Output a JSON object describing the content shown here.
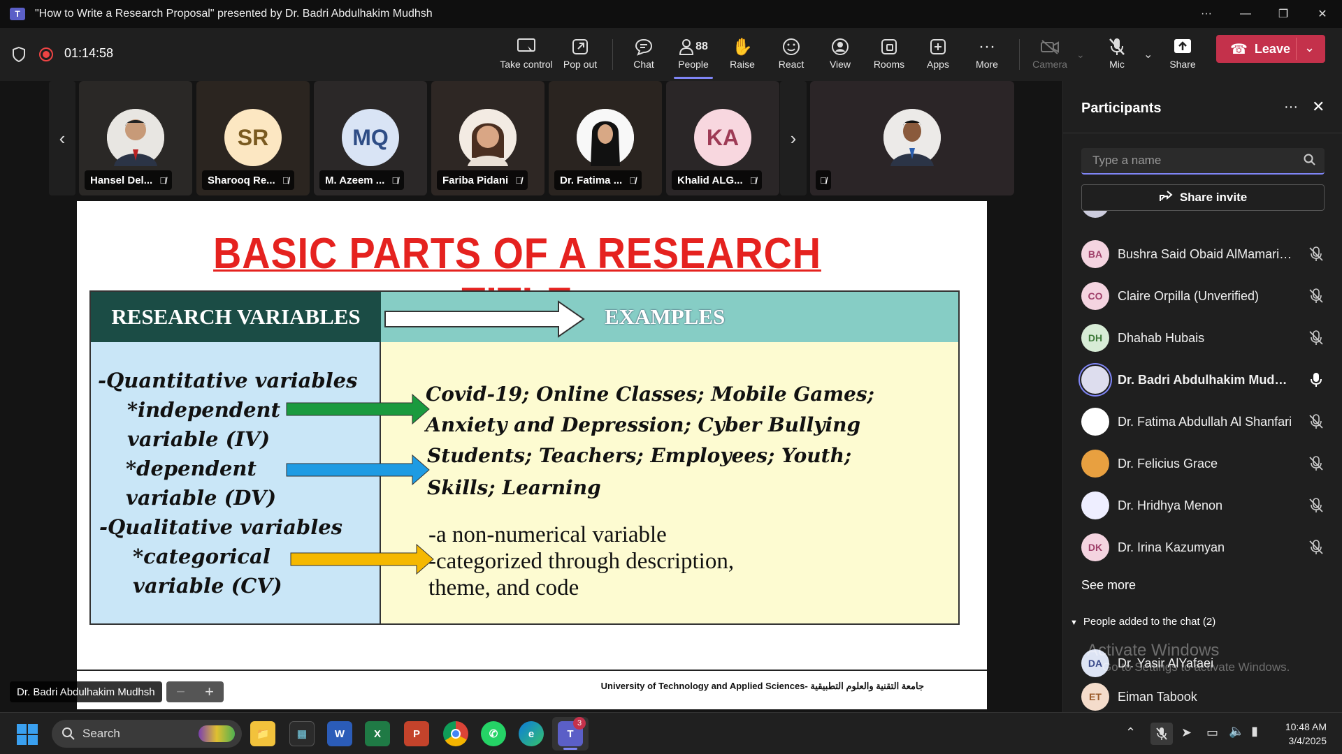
{
  "window": {
    "title": "\"How to Write a Research Proposal\" presented by Dr. Badri Abdulhakim Mudhsh",
    "icon": "teams-icon"
  },
  "toolbar": {
    "timer": "01:14:58",
    "take_control": "Take control",
    "pop_out": "Pop out",
    "chat": "Chat",
    "people": "People",
    "people_count": "88",
    "raise": "Raise",
    "react": "React",
    "view": "View",
    "rooms": "Rooms",
    "apps": "Apps",
    "more": "More",
    "camera": "Camera",
    "mic": "Mic",
    "share": "Share",
    "leave": "Leave"
  },
  "tiles": [
    {
      "name": "Hansel Del...",
      "initials": "",
      "type": "photo"
    },
    {
      "name": "Sharooq Re...",
      "initials": "SR",
      "type": "initials"
    },
    {
      "name": "M. Azeem ...",
      "initials": "MQ",
      "type": "initials"
    },
    {
      "name": "Fariba Pidani",
      "initials": "",
      "type": "photo"
    },
    {
      "name": "Dr. Fatima ...",
      "initials": "",
      "type": "photo"
    },
    {
      "name": "Khalid ALG...",
      "initials": "KA",
      "type": "initials"
    },
    {
      "name": "",
      "initials": "",
      "type": "photo"
    }
  ],
  "slide": {
    "title": "BASIC PARTS OF A RESEARCH TITLE",
    "header_left": "RESEARCH VARIABLES",
    "header_right": "EXAMPLES",
    "left": {
      "quant": "-Quantitative variables",
      "iv1": "*independent",
      "iv2": "variable (IV)",
      "dv1": "*dependent",
      "dv2": "variable (DV)",
      "qual": "-Qualitative variables",
      "cv1": "*categorical",
      "cv2": "variable (CV)"
    },
    "right": {
      "iv_line1": "Covid-19; Online Classes; Mobile Games;",
      "iv_line2": "Anxiety and Depression;  Cyber Bullying",
      "dv_line1": "Students; Teachers; Employees;  Youth;",
      "dv_line2": "Skills; Learning",
      "cv_line1": "-a non-numerical variable",
      "cv_line2": "-categorized through description,",
      "cv_line3": "theme, and code"
    },
    "footer": "University of Technology and Applied Sciences- جامعة التقنية والعلوم التطبيقية",
    "colors": {
      "title": "#e5221f",
      "arrow_iv": "#1a9a3e",
      "arrow_dv": "#1e9be3",
      "arrow_cv": "#f5b800"
    }
  },
  "presenter_label": "Dr. Badri Abdulhakim Mudhsh",
  "panel": {
    "title": "Participants",
    "search_placeholder": "Type a name",
    "share_invite": "Share invite",
    "participants": [
      {
        "initials": "BA",
        "name": "Bushra Said Obaid AlMamari.S...",
        "color": "#f4d4e0",
        "fg": "#a0406a",
        "bold": false,
        "mic": "muted"
      },
      {
        "initials": "CO",
        "name": "Claire Orpilla (Unverified)",
        "color": "#f4d4e0",
        "fg": "#a0406a",
        "bold": false,
        "mic": "muted"
      },
      {
        "initials": "DH",
        "name": "Dhahab Hubais",
        "color": "#d7ecd6",
        "fg": "#3d7a3a",
        "bold": false,
        "mic": "muted"
      },
      {
        "initials": "",
        "name": "Dr. Badri Abdulhakim Mudhsh",
        "color": "#dde",
        "fg": "#333",
        "bold": true,
        "mic": "on"
      },
      {
        "initials": "",
        "name": "Dr. Fatima Abdullah Al Shanfari",
        "color": "#fff",
        "fg": "#333",
        "bold": false,
        "mic": "muted"
      },
      {
        "initials": "",
        "name": "Dr. Felicius Grace",
        "color": "#e8a040",
        "fg": "#333",
        "bold": false,
        "mic": "muted"
      },
      {
        "initials": "",
        "name": "Dr. Hridhya Menon",
        "color": "#eef",
        "fg": "#333",
        "bold": false,
        "mic": "muted"
      },
      {
        "initials": "DK",
        "name": "Dr. Irina Kazumyan",
        "color": "#f4d4e0",
        "fg": "#a0406a",
        "bold": false,
        "mic": "muted"
      }
    ],
    "see_more": "See more",
    "added_header": "People added to the chat (2)",
    "added": [
      {
        "initials": "DA",
        "name": "Dr. Yasir AlYafaei",
        "color": "#dde4f4",
        "fg": "#3a4a8a"
      },
      {
        "initials": "ET",
        "name": "Eiman Tabook",
        "color": "#f4dccb",
        "fg": "#9a5a2a"
      }
    ],
    "activate_line1": "Activate Windows",
    "activate_line2": "Go to Settings to activate Windows."
  },
  "taskbar": {
    "search": "Search",
    "teams_badge": "3",
    "time": "10:48 AM",
    "date": "3/4/2025"
  }
}
